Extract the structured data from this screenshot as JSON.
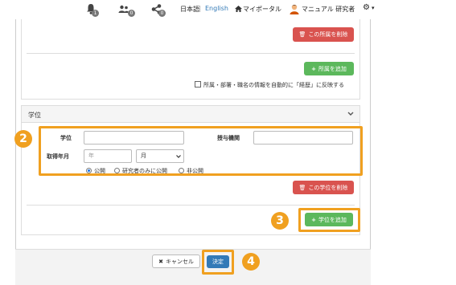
{
  "nav": {
    "bell_count": "1",
    "users_count": "0",
    "share_count": "0",
    "lang_ja": "日本語",
    "lang_sep": " | ",
    "lang_en": "English",
    "myportal": "マイポータル",
    "user_name": "マニュアル 研究者",
    "settings_caret": "▾"
  },
  "affiliation": {
    "delete_button": "この所属を削除",
    "add_button": "所属を追加",
    "reflect_checkbox_label": "所属・部署・職名の情報を自動的に「経歴」に反映する"
  },
  "degree": {
    "section_title": "学位",
    "degree_label": "学位",
    "degree_value": "",
    "institution_label": "授与機関",
    "institution_value": "",
    "date_label": "取得年月",
    "year_placeholder": "年",
    "month_value": "月",
    "visibility_options": [
      "公開",
      "研究者のみに公開",
      "非公開"
    ],
    "visibility_selected": 0,
    "delete_button": "この学位を削除",
    "add_button": "学位を追加"
  },
  "footer": {
    "cancel_button": "キャンセル",
    "submit_button": "決定"
  },
  "steps": [
    "2",
    "3",
    "4"
  ],
  "colors": {
    "highlight": "#f0a020",
    "danger": "#d9534f",
    "success": "#5cb85c",
    "primary": "#337ab7"
  }
}
